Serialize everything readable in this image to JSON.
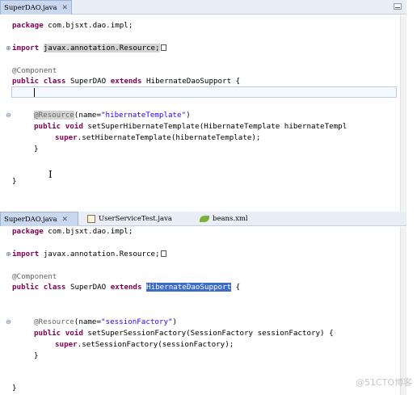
{
  "top_editor": {
    "tab_label": "SuperDAO.java",
    "tab_close": "✕",
    "line_package": [
      "package",
      " com.bjsxt.dao.impl;"
    ],
    "line_import": [
      "import",
      " ",
      "javax.annotation.Resource;"
    ],
    "line_component": "@Component",
    "line_class": [
      "public",
      " ",
      "class",
      " SuperDAO ",
      "extends",
      " HibernateDaoSupport {"
    ],
    "line_resource": [
      "@Resource",
      "(name=",
      "\"hibernateTemplate\"",
      ")"
    ],
    "line_method": [
      "public",
      " ",
      "void",
      " setSuperHibernateTemplate(HibernateTemplate hibernateTempl"
    ],
    "line_super": [
      "super",
      ".setHibernateTemplate(hibernateTemplate);"
    ],
    "line_close_method": "}",
    "line_close_class": "}"
  },
  "bottom_editor": {
    "tabs": [
      {
        "label": "SuperDAO.java",
        "close": "✕"
      },
      {
        "label": "UserServiceTest.java",
        "close": ""
      },
      {
        "label": "beans.xml",
        "close": ""
      }
    ],
    "line_package": [
      "package",
      " com.bjsxt.dao.impl;"
    ],
    "line_import": [
      "import",
      " javax.annotation.Resource;"
    ],
    "line_component": "@Component",
    "line_class": [
      "public",
      " ",
      "class",
      " SuperDAO ",
      "extends",
      " ",
      "HibernateDaoSupport",
      " {"
    ],
    "line_resource": [
      "@Resource",
      "(name=",
      "\"sessionFactory\"",
      ")"
    ],
    "line_method": [
      "public",
      " ",
      "void",
      " setSuperSessionFactory(SessionFactory sessionFactory) {"
    ],
    "line_super": [
      "super",
      ".setSessionFactory(sessionFactory);"
    ],
    "line_close_method": "}",
    "line_close_class": "}"
  },
  "gutter": {
    "expand": "⊕",
    "collapse": "⊖"
  },
  "watermark": "@51CTO博客",
  "ibeam_glyph": "I"
}
